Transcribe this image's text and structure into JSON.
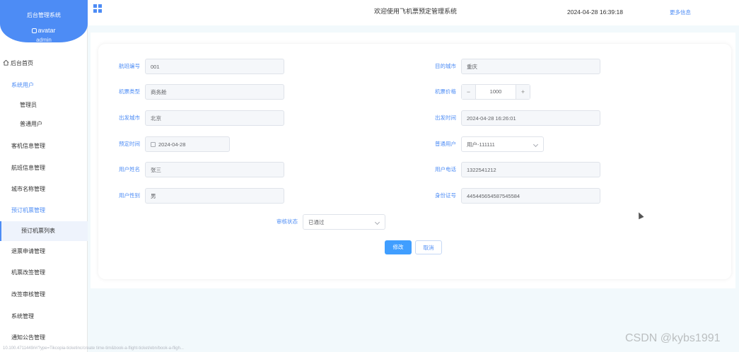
{
  "brand": {
    "title": "后台管理系统",
    "avatar_alt": "avatar",
    "username": "admin"
  },
  "header": {
    "title": "欢迎使用飞机票预定管理系统",
    "datetime": "2024-04-28 16:39:18",
    "more": "更多信息"
  },
  "menu": {
    "home": "后台首页",
    "system_users": "系统用户",
    "admin": "管理员",
    "normal_user": "普通用户",
    "plane_info": "客机信息管理",
    "flight_info": "航班信息管理",
    "city_name": "城市名称管理",
    "booking_group": "预订机票管理",
    "booking_list": "预订机票列表",
    "refund": "退票申请管理",
    "change_apply": "机票改签管理",
    "change_review": "改签审核管理",
    "system_manage": "系统管理",
    "notice": "通知公告管理"
  },
  "form": {
    "flight_no": {
      "label": "航班编号",
      "value": "001"
    },
    "dest_city": {
      "label": "目的城市",
      "value": "重庆"
    },
    "ticket_type": {
      "label": "机票类型",
      "value": "商务舱"
    },
    "price": {
      "label": "机票价格",
      "value": "1000",
      "minus": "−",
      "plus": "+"
    },
    "depart_city": {
      "label": "出发城市",
      "value": "北京"
    },
    "depart_time": {
      "label": "出发时间",
      "value": "2024-04-28 16:26:01"
    },
    "book_time": {
      "label": "预定时间",
      "value": "2024-04-28"
    },
    "normal_user": {
      "label": "普通用户",
      "value": "用户-111111"
    },
    "user_name": {
      "label": "用户姓名",
      "value": "张三"
    },
    "user_phone": {
      "label": "用户电话",
      "value": "1322541212"
    },
    "user_gender": {
      "label": "用户性别",
      "value": "男"
    },
    "id_number": {
      "label": "身份证号",
      "value": "445445654587545584"
    },
    "review_status": {
      "label": "审核状态",
      "value": "已通过"
    }
  },
  "buttons": {
    "submit": "修改",
    "cancel": "取消"
  },
  "watermark": "CSDN @kybs1991",
  "statusbar": "10.100.4711449/#/?ype=Tikcopia-ticketinc/create time-tim&book-a-flight-ticket/ebn/book-a-fligh..."
}
